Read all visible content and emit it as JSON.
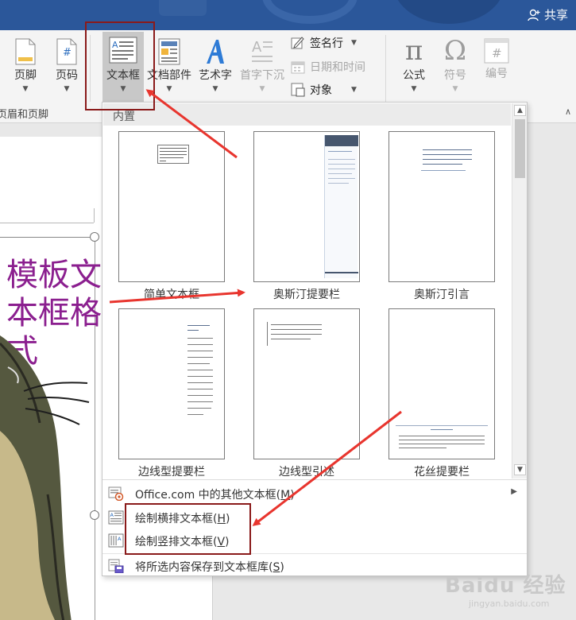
{
  "titlebar": {
    "share_label": "共享"
  },
  "ribbon": {
    "buttons": {
      "footer": "页脚",
      "page_number": "页码",
      "textbox": "文本框",
      "quick_parts": "文档部件",
      "wordart": "艺术字",
      "drop_cap": "首字下沉",
      "equation": "公式",
      "symbol": "符号",
      "number": "编号"
    },
    "small": {
      "signature_line": "签名行",
      "date_time": "日期和时间",
      "object": "对象"
    },
    "group_label": "页眉和页脚"
  },
  "document": {
    "text": "模板文本框格式"
  },
  "gallery": {
    "header": "内置",
    "tiles": [
      "简单文本框",
      "奥斯汀提要栏",
      "奥斯汀引言",
      "边线型提要栏",
      "边线型引述",
      "花丝提要栏"
    ]
  },
  "menu": {
    "office_more": {
      "label": "Office.com 中的其他文本框",
      "key": "M"
    },
    "draw_horizontal": {
      "label": "绘制横排文本框",
      "key": "H"
    },
    "draw_vertical": {
      "label": "绘制竖排文本框",
      "key": "V"
    },
    "save_selection": {
      "label": "将所选内容保存到文本框库",
      "key": "S"
    }
  },
  "watermark": {
    "brand": "Baidu 经验",
    "url": "jingyan.baidu.com"
  }
}
